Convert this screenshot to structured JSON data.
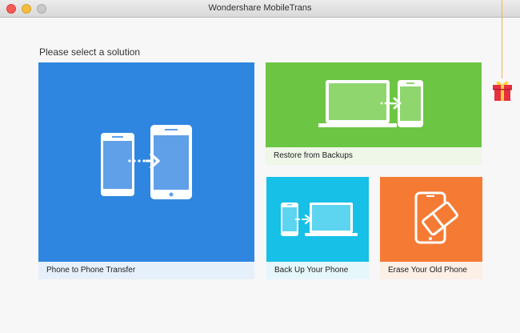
{
  "window": {
    "title": "Wondershare MobileTrans"
  },
  "heading": "Please select a solution",
  "tiles": [
    {
      "label": "Phone to Phone Transfer",
      "color": "#2f86e0"
    },
    {
      "label": "Restore from Backups",
      "color": "#6cc644"
    },
    {
      "label": "Back Up Your Phone",
      "color": "#17c0e6"
    },
    {
      "label": "Erase Your Old Phone",
      "color": "#f57b35"
    }
  ],
  "icons": [
    "phone-transfer-icon",
    "laptop-to-phone-icon",
    "phone-to-laptop-icon",
    "erase-phone-icon",
    "gift-icon"
  ]
}
